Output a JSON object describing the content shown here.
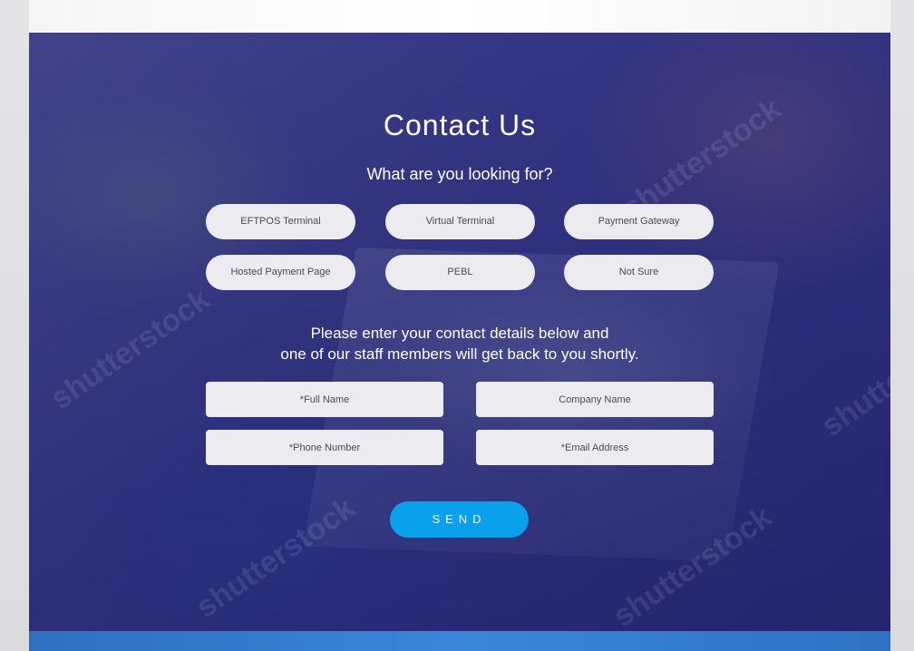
{
  "contact": {
    "title": "Contact Us",
    "subtitle": "What are you looking for?",
    "options": [
      {
        "label": "EFTPOS Terminal"
      },
      {
        "label": "Virtual Terminal"
      },
      {
        "label": "Payment Gateway"
      },
      {
        "label": "Hosted Payment Page"
      },
      {
        "label": "PEBL"
      },
      {
        "label": "Not Sure"
      }
    ],
    "instructions_line1": "Please enter your contact details below and",
    "instructions_line2": "one of our staff members will get back to you shortly.",
    "fields": {
      "full_name_placeholder": "*Full Name",
      "company_name_placeholder": "Company Name",
      "phone_placeholder": "*Phone Number",
      "email_placeholder": "*Email Address"
    },
    "send_label": "SEND"
  },
  "watermark": "shutterstock",
  "colors": {
    "overlay": "#2d3082",
    "pill_bg": "#ececf0",
    "send_button": "#0aa1ec",
    "bottom_strip": "#3a86d8"
  }
}
